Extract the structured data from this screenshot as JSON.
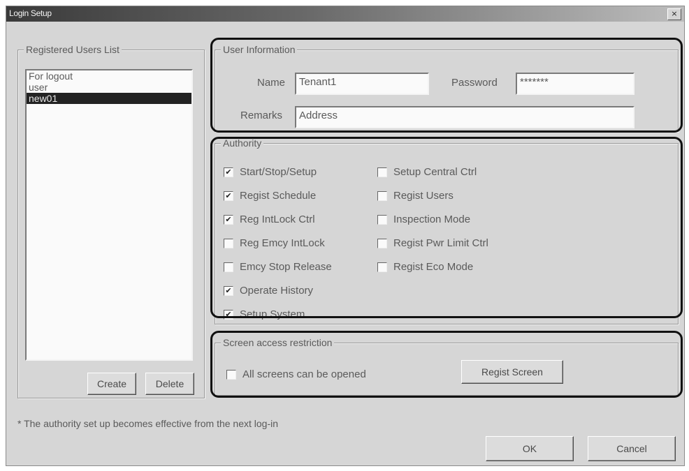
{
  "window": {
    "title": "Login Setup",
    "close_glyph": "×"
  },
  "users": {
    "legend": "Registered Users List",
    "items": [
      {
        "label": "For logout",
        "selected": false
      },
      {
        "label": "user",
        "selected": false
      },
      {
        "label": "new01",
        "selected": true
      }
    ],
    "create_label": "Create",
    "delete_label": "Delete"
  },
  "user_info": {
    "legend": "User Information",
    "name_label": "Name",
    "name_value": "Tenant1",
    "password_label": "Password",
    "password_value": "*******",
    "remarks_label": "Remarks",
    "remarks_value": "Address"
  },
  "authority": {
    "legend": "Authority",
    "left": [
      {
        "label": "Start/Stop/Setup",
        "checked": true
      },
      {
        "label": "Regist Schedule",
        "checked": true
      },
      {
        "label": "Reg IntLock Ctrl",
        "checked": true
      },
      {
        "label": "Reg Emcy IntLock",
        "checked": false
      },
      {
        "label": "Emcy Stop Release",
        "checked": false
      },
      {
        "label": "Operate History",
        "checked": true
      },
      {
        "label": "Setup System",
        "checked": true
      }
    ],
    "right": [
      {
        "label": "Setup Central Ctrl",
        "checked": false
      },
      {
        "label": "Regist Users",
        "checked": false
      },
      {
        "label": "Inspection Mode",
        "checked": false
      },
      {
        "label": "Regist Pwr Limit Ctrl",
        "checked": false
      },
      {
        "label": "Regist Eco Mode",
        "checked": false
      }
    ]
  },
  "screen_access": {
    "legend": "Screen access restriction",
    "all_screens_label": "All screens can be opened",
    "all_screens_checked": false,
    "regist_screen_label": "Regist Screen"
  },
  "note": "* The authority set up becomes effective from the next log-in",
  "footer": {
    "ok_label": "OK",
    "cancel_label": "Cancel"
  },
  "check_glyph": "✔"
}
